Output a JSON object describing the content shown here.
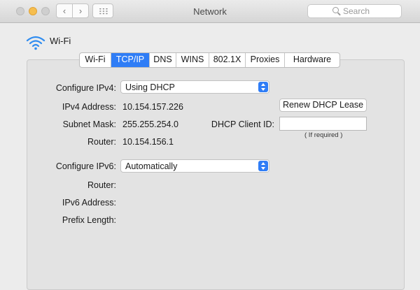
{
  "window": {
    "title": "Network"
  },
  "toolbar": {
    "search_placeholder": "Search"
  },
  "header": {
    "interface_name": "Wi-Fi"
  },
  "tabs": [
    {
      "label": "Wi-Fi",
      "active": false
    },
    {
      "label": "TCP/IP",
      "active": true
    },
    {
      "label": "DNS",
      "active": false
    },
    {
      "label": "WINS",
      "active": false
    },
    {
      "label": "802.1X",
      "active": false
    },
    {
      "label": "Proxies",
      "active": false
    },
    {
      "label": "Hardware",
      "active": false
    }
  ],
  "ipv4": {
    "configure_label": "Configure IPv4:",
    "configure_value": "Using DHCP",
    "address_label": "IPv4 Address:",
    "address_value": "10.154.157.226",
    "subnet_label": "Subnet Mask:",
    "subnet_value": "255.255.254.0",
    "router_label": "Router:",
    "router_value": "10.154.156.1"
  },
  "dhcp": {
    "renew_label": "Renew DHCP Lease",
    "client_id_label": "DHCP Client ID:",
    "client_id_value": "",
    "client_id_hint": "( If required )"
  },
  "ipv6": {
    "configure_label": "Configure IPv6:",
    "configure_value": "Automatically",
    "router_label": "Router:",
    "address_label": "IPv6 Address:",
    "prefix_label": "Prefix Length:"
  },
  "colors": {
    "accent": "#2f7df6",
    "wifi_icon": "#2f8cf0",
    "minimize_light": "#f6be4f"
  }
}
